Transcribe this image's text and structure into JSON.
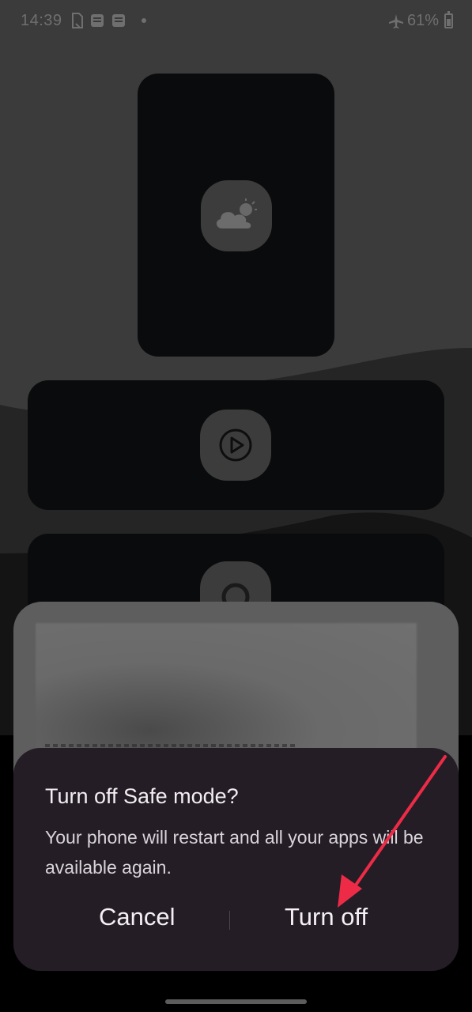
{
  "status_bar": {
    "time": "14:39",
    "battery": "61%",
    "icons": [
      "no-sim-icon",
      "notification-icon",
      "notification-icon",
      "dot-icon",
      "airplane-icon",
      "battery-icon"
    ]
  },
  "recents": {
    "cards": [
      {
        "app_icon": "weather-icon"
      },
      {
        "app_icon": "play-icon"
      },
      {
        "app_icon": "browser-icon"
      }
    ]
  },
  "dialog": {
    "title": "Turn off Safe mode?",
    "message": "Your phone will restart and all your apps will be available again.",
    "cancel_label": "Cancel",
    "confirm_label": "Turn off"
  },
  "colors": {
    "dialog_bg": "#241d25",
    "annotation_arrow": "#ee2b47"
  }
}
